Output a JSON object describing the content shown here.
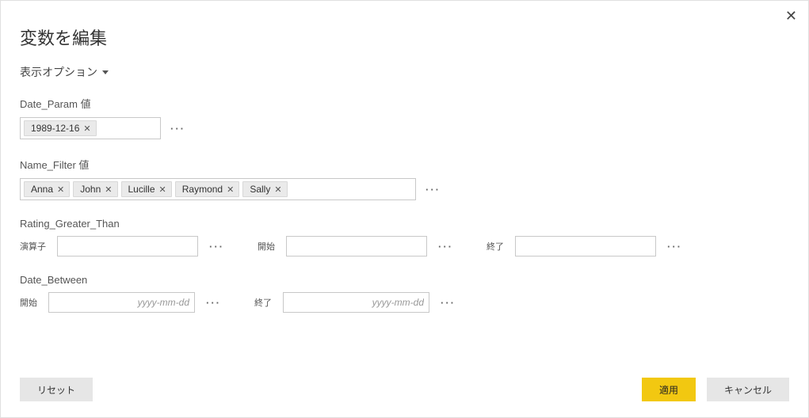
{
  "dialog": {
    "title": "変数を編集",
    "displayOptions": "表示オプション"
  },
  "sections": {
    "dateParam": {
      "label": "Date_Param 値",
      "tokens": [
        "1989-12-16"
      ]
    },
    "nameFilter": {
      "label": "Name_Filter 値",
      "tokens": [
        "Anna",
        "John",
        "Lucille",
        "Raymond",
        "Sally"
      ]
    },
    "ratingGreater": {
      "label": "Rating_Greater_Than",
      "operatorLabel": "演算子",
      "operatorValue": "",
      "startLabel": "開始",
      "startValue": "",
      "endLabel": "終了",
      "endValue": ""
    },
    "dateBetween": {
      "label": "Date_Between",
      "startLabel": "開始",
      "startPlaceholder": "yyyy-mm-dd",
      "endLabel": "終了",
      "endPlaceholder": "yyyy-mm-dd"
    }
  },
  "buttons": {
    "reset": "リセット",
    "apply": "適用",
    "cancel": "キャンセル"
  }
}
